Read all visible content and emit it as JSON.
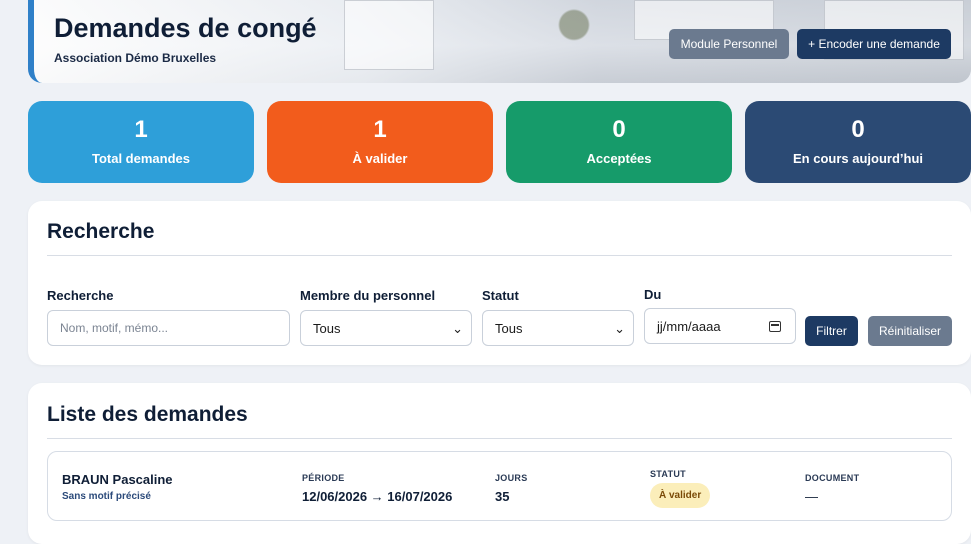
{
  "header": {
    "title": "Demandes de congé",
    "subtitle": "Association Démo Bruxelles",
    "module_button": "Module Personnel",
    "new_request_button": "+ Encoder une demande"
  },
  "stats": [
    {
      "value": "1",
      "label": "Total demandes",
      "color": "#2e9fd9"
    },
    {
      "value": "1",
      "label": "À valider",
      "color": "#f25c1c"
    },
    {
      "value": "0",
      "label": "Acceptées",
      "color": "#169b6a"
    },
    {
      "value": "0",
      "label": "En cours aujourd’hui",
      "color": "#2b4a74"
    }
  ],
  "search": {
    "title": "Recherche",
    "query_label": "Recherche",
    "query_placeholder": "Nom, motif, mémo...",
    "member_label": "Membre du personnel",
    "member_value": "Tous",
    "status_label": "Statut",
    "status_value": "Tous",
    "from_label": "Du",
    "from_placeholder": "jj/mm/aaaa",
    "filter_button": "Filtrer",
    "reset_button": "Réinitialiser"
  },
  "list": {
    "title": "Liste des demandes",
    "items": [
      {
        "name": "BRAUN Pascaline",
        "motif": "Sans motif précisé",
        "period_label": "PÉRIODE",
        "period": "12/06/2026 → 16/07/2026",
        "days_label": "JOURS",
        "days": "35",
        "status_label": "STATUT",
        "status": "À valider",
        "document_label": "DOCUMENT",
        "document": "—"
      }
    ]
  }
}
